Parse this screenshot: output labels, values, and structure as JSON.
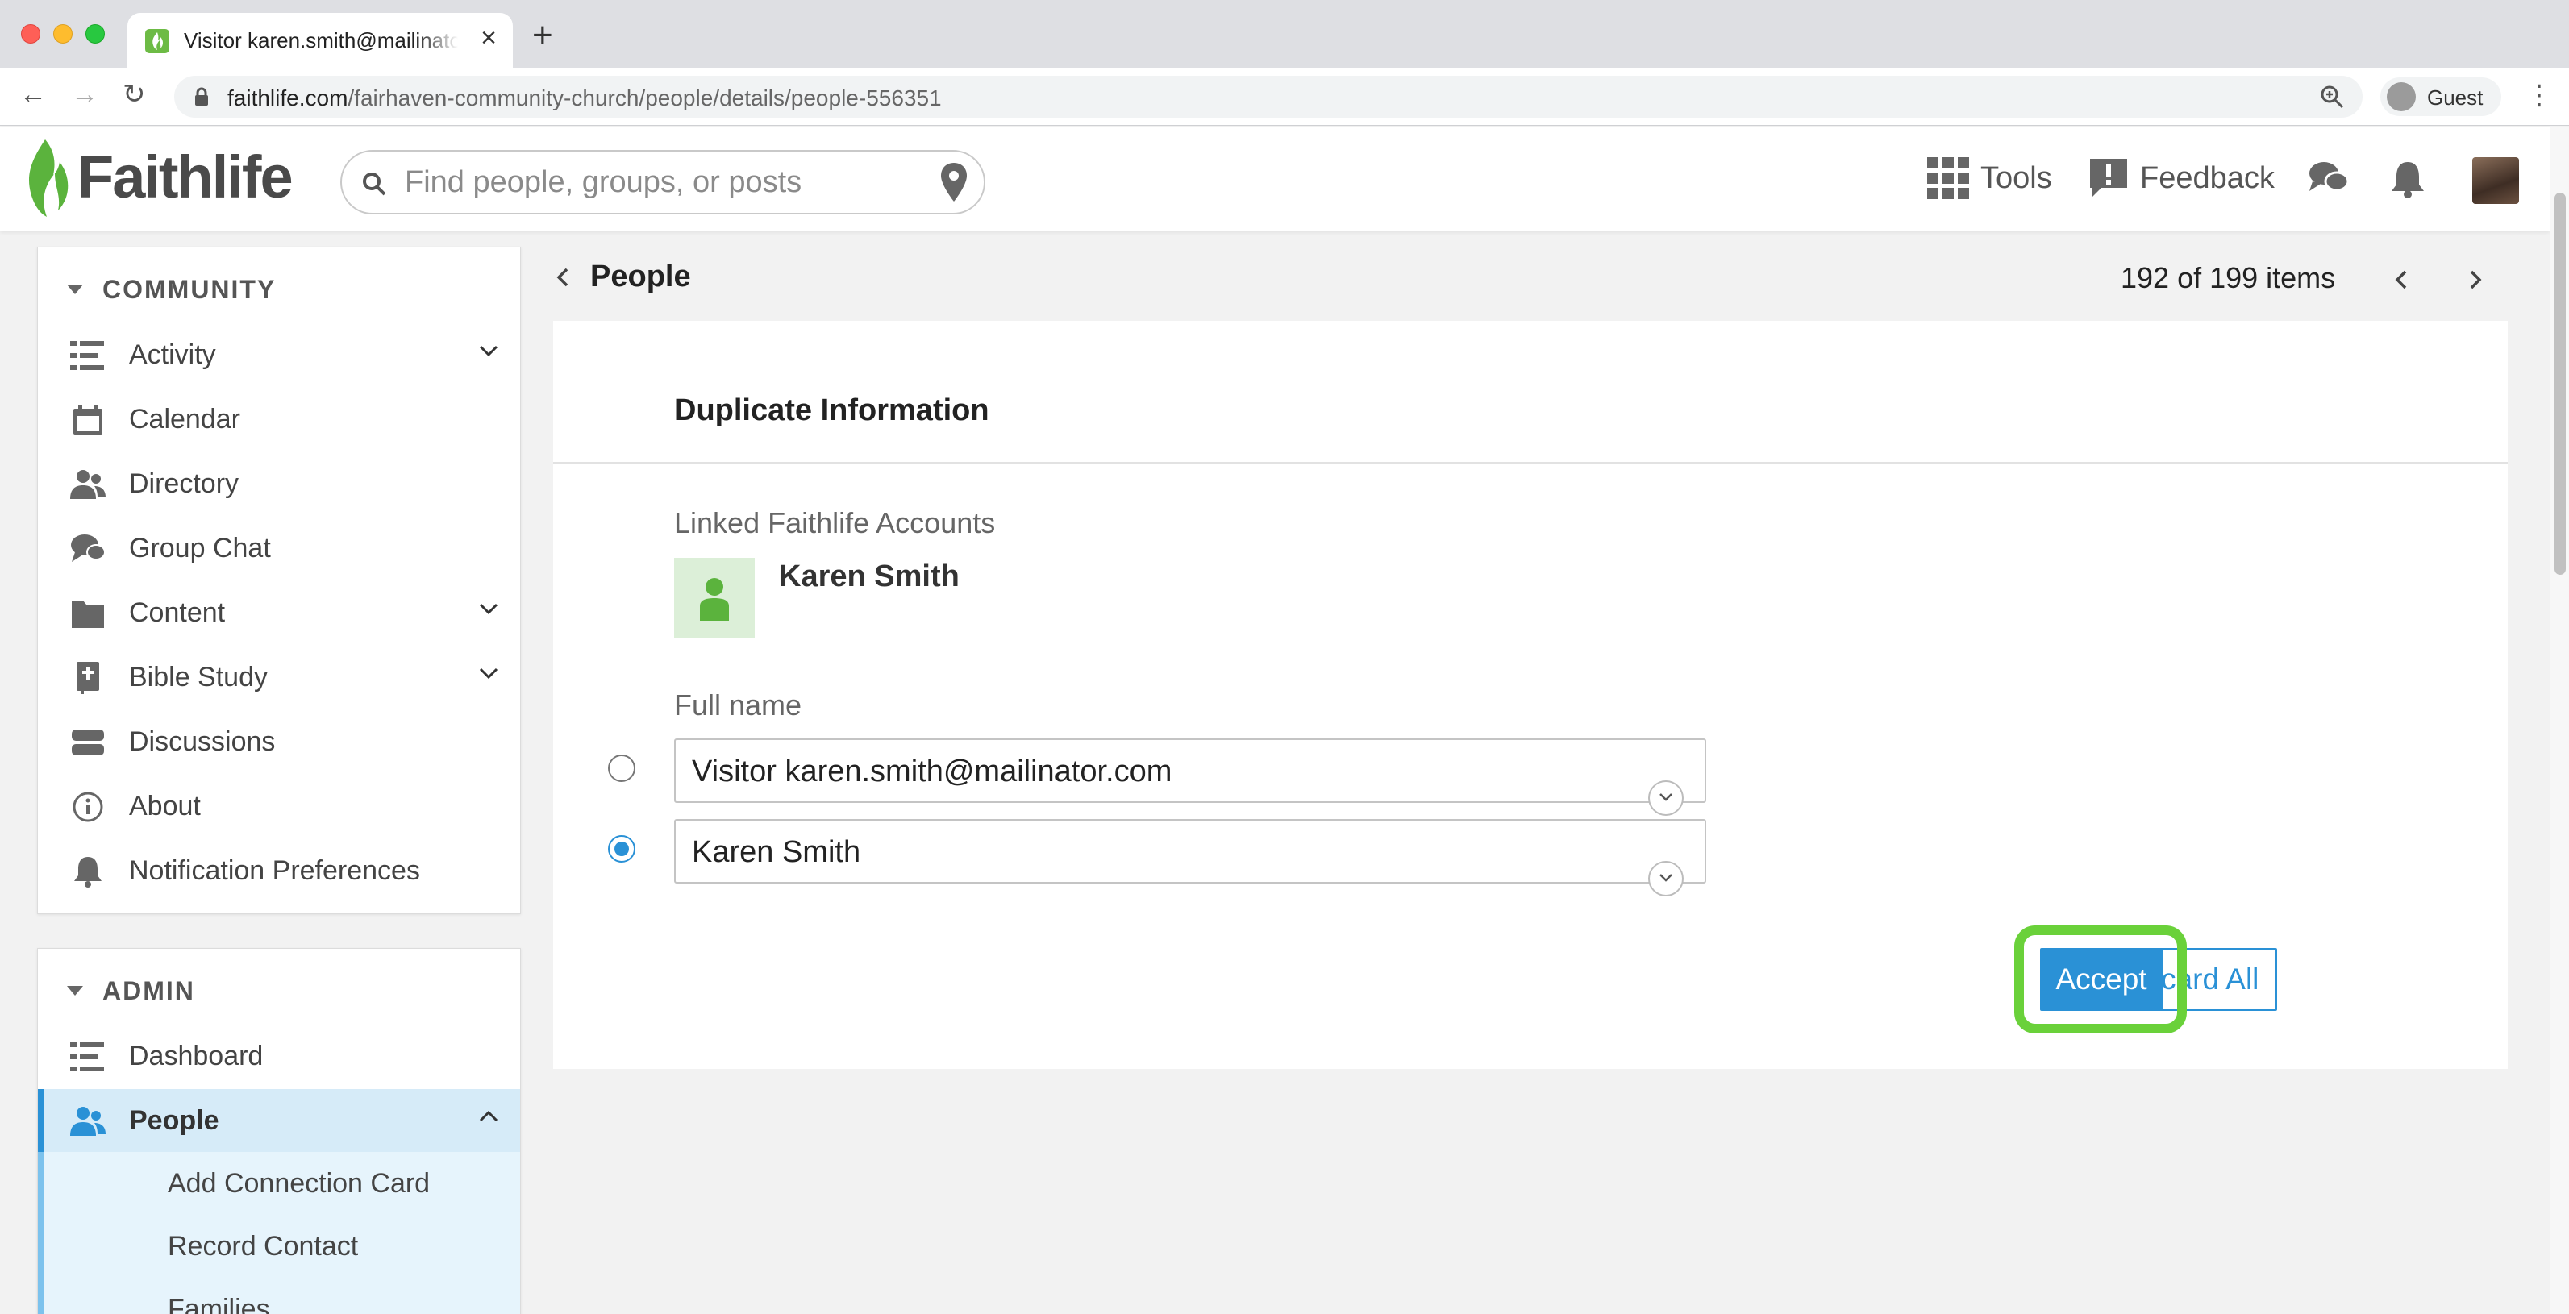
{
  "browser": {
    "tab_title": "Visitor karen.smith@mailinator.com",
    "url_domain": "faithlife.com",
    "url_path": "/fairhaven-community-church/people/details/people-556351",
    "profile_label": "Guest"
  },
  "header": {
    "logo_text": "Faithlife",
    "search_placeholder": "Find people, groups, or posts",
    "tools_label": "Tools",
    "feedback_label": "Feedback"
  },
  "sidebar": {
    "community_title": "COMMUNITY",
    "community_items": [
      {
        "label": "Activity",
        "icon": "activity-icon",
        "expandable": true
      },
      {
        "label": "Calendar",
        "icon": "calendar-icon",
        "expandable": false
      },
      {
        "label": "Directory",
        "icon": "directory-icon",
        "expandable": false
      },
      {
        "label": "Group Chat",
        "icon": "chat-icon",
        "expandable": false
      },
      {
        "label": "Content",
        "icon": "folder-icon",
        "expandable": true
      },
      {
        "label": "Bible Study",
        "icon": "bible-icon",
        "expandable": true
      },
      {
        "label": "Discussions",
        "icon": "discussions-icon",
        "expandable": false
      },
      {
        "label": "About",
        "icon": "info-icon",
        "expandable": false
      },
      {
        "label": "Notification Preferences",
        "icon": "bell-icon",
        "expandable": false
      }
    ],
    "admin_title": "ADMIN",
    "admin_items": [
      {
        "label": "Dashboard",
        "icon": "dashboard-icon"
      },
      {
        "label": "People",
        "icon": "people-icon",
        "active": true
      }
    ],
    "people_subitems": [
      "Add Connection Card",
      "Record Contact",
      "Families"
    ]
  },
  "main": {
    "breadcrumb": "People",
    "pager_text": "192 of 199 items",
    "panel_title": "Duplicate Information",
    "linked_accounts_label": "Linked Faithlife Accounts",
    "linked_account_name": "Karen Smith",
    "full_name_label": "Full name",
    "full_name_options": [
      {
        "value": "Visitor karen.smith@mailinator.com",
        "selected": false
      },
      {
        "value": "Karen Smith",
        "selected": true
      }
    ],
    "discard_label": "Discard All",
    "accept_label": "Accept"
  },
  "colors": {
    "accent": "#2a91d6",
    "brand_green": "#6dbb45",
    "highlight_ring": "#6ad13a"
  }
}
